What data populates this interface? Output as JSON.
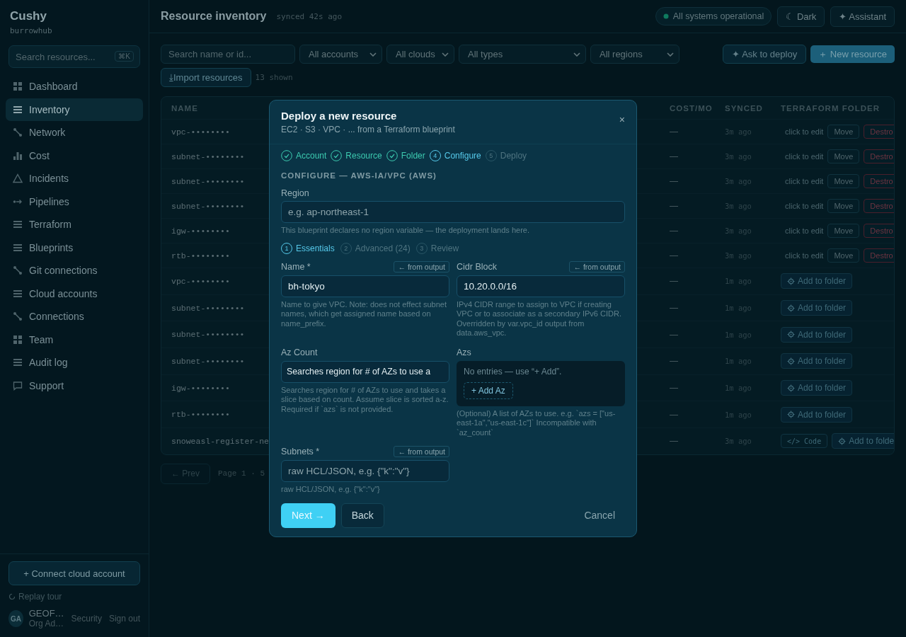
{
  "sidebar": {
    "logo": "Cushy",
    "workspace": "burrowhub",
    "search": {
      "placeholder": "Search resources...",
      "shortcut": "⌘K"
    },
    "nav": [
      {
        "label": "Dashboard",
        "kind": "grid",
        "selected": false
      },
      {
        "label": "Inventory",
        "kind": "stack",
        "selected": true
      },
      {
        "label": "Network",
        "kind": "branch",
        "selected": false
      },
      {
        "label": "Cost",
        "kind": "bars",
        "selected": false
      },
      {
        "label": "Incidents",
        "kind": "triangle",
        "selected": false
      },
      {
        "label": "Pipelines",
        "kind": "flow",
        "selected": false
      },
      {
        "label": "Terraform",
        "kind": "stack",
        "selected": false
      },
      {
        "label": "Blueprints",
        "kind": "stack",
        "selected": false
      },
      {
        "label": "Git connections",
        "kind": "branch",
        "selected": false
      },
      {
        "label": "Cloud accounts",
        "kind": "stack",
        "selected": false
      },
      {
        "label": "Connections",
        "kind": "branch",
        "selected": false
      },
      {
        "label": "Team",
        "kind": "grid",
        "selected": false
      },
      {
        "label": "Audit log",
        "kind": "stack",
        "selected": false
      },
      {
        "label": "Support",
        "kind": "chat",
        "selected": false
      }
    ],
    "connect_button": "+ Connect cloud account",
    "replay": "Replay tour",
    "user": {
      "initials": "GA",
      "name": "GEOF…",
      "role": "Org Ad…"
    },
    "links": [
      "Security",
      "Sign out"
    ]
  },
  "header": {
    "title": "Resource inventory",
    "synced": "synced 42s ago",
    "status": "All systems operational",
    "buttons": [
      "☾ Dark",
      "✦ Assistant"
    ]
  },
  "filters": {
    "search": {
      "placeholder": "Search name or id..."
    },
    "selects": [
      "All accounts",
      "All clouds",
      "All types",
      "All regions"
    ],
    "ask_button": "✦ Ask to deploy",
    "new_button": "＋ New resource",
    "import_button": "⤓Import resources",
    "count": "13 shown"
  },
  "table": {
    "columns": [
      "NAME",
      "COST/MO",
      "SYNCED",
      "TERRAFORM FOLDER"
    ],
    "rows": [
      {
        "name": "vpc-••••••••",
        "cost": "—",
        "synced": "3m ago",
        "folder": {
          "kind": "edit",
          "hint": "click to edit",
          "move": "Move",
          "destroy": "Destro"
        }
      },
      {
        "name": "subnet-••••••••",
        "cost": "—",
        "synced": "3m ago",
        "folder": {
          "kind": "edit",
          "hint": "click to edit",
          "move": "Move",
          "destroy": "Destro"
        }
      },
      {
        "name": "subnet-••••••••",
        "cost": "—",
        "synced": "3m ago",
        "folder": {
          "kind": "edit",
          "hint": "click to edit",
          "move": "Move",
          "destroy": "Destro"
        }
      },
      {
        "name": "subnet-••••••••",
        "cost": "—",
        "synced": "3m ago",
        "folder": {
          "kind": "edit",
          "hint": "click to edit",
          "move": "Move",
          "destroy": "Destro"
        }
      },
      {
        "name": "igw-••••••••",
        "cost": "—",
        "synced": "3m ago",
        "folder": {
          "kind": "edit",
          "hint": "click to edit",
          "move": "Move",
          "destroy": "Destro"
        }
      },
      {
        "name": "rtb-••••••••",
        "cost": "—",
        "synced": "3m ago",
        "folder": {
          "kind": "edit",
          "hint": "click to edit",
          "move": "Move",
          "destroy": "Destro"
        }
      },
      {
        "name": "vpc-••••••••",
        "cost": "—",
        "synced": "1m ago",
        "folder": {
          "kind": "add",
          "add": "Add to folder"
        }
      },
      {
        "name": "subnet-••••••••",
        "cost": "—",
        "synced": "1m ago",
        "folder": {
          "kind": "add",
          "add": "Add to folder"
        }
      },
      {
        "name": "subnet-••••••••",
        "cost": "—",
        "synced": "1m ago",
        "folder": {
          "kind": "add",
          "add": "Add to folder"
        }
      },
      {
        "name": "subnet-••••••••",
        "cost": "—",
        "synced": "1m ago",
        "folder": {
          "kind": "add",
          "add": "Add to folder"
        }
      },
      {
        "name": "igw-••••••••",
        "cost": "—",
        "synced": "1m ago",
        "folder": {
          "kind": "add",
          "add": "Add to folder"
        }
      },
      {
        "name": "rtb-••••••••",
        "cost": "—",
        "synced": "1m ago",
        "folder": {
          "kind": "add",
          "add": "Add to folder"
        }
      },
      {
        "name": "snoweasl-register-ne",
        "cost": "—",
        "synced": "3m ago",
        "folder": {
          "kind": "code",
          "code": "</> Code",
          "add": "Add to folde"
        }
      }
    ]
  },
  "pagination": {
    "prev": "← Prev",
    "page": "Page 1 · 5"
  },
  "modal": {
    "title": "Deploy a new resource",
    "subtitle": "EC2 · S3 · VPC · ... from a Terraform blueprint",
    "close": "×",
    "steps": [
      {
        "label": "Account",
        "done": true,
        "selected": false
      },
      {
        "label": "Resource",
        "done": true,
        "selected": false
      },
      {
        "label": "Folder",
        "done": true,
        "selected": false
      },
      {
        "label": "Configure",
        "number": "4",
        "done": false,
        "selected": true
      },
      {
        "label": "Deploy",
        "number": "5",
        "done": false,
        "selected": false
      }
    ],
    "section": "CONFIGURE — AWS-IA/VPC (AWS)",
    "region": {
      "label": "Region",
      "placeholder": "e.g. ap-northeast-1",
      "help": "This blueprint declares no region variable — the deployment lands here."
    },
    "substeps": [
      {
        "number": "1",
        "label": "Essentials",
        "selected": true
      },
      {
        "number": "2",
        "label": "Advanced (24)",
        "selected": false
      },
      {
        "number": "3",
        "label": "Review",
        "selected": false
      }
    ],
    "fields": [
      {
        "kind": "input",
        "label": "Name *",
        "link": "← from output",
        "value": "bh-tokyo",
        "help": "Name to give VPC. Note: does not effect subnet names, which get assigned name based on name_prefix."
      },
      {
        "kind": "input",
        "label": "Cidr Block",
        "link": "← from output",
        "value": "10.20.0.0/16",
        "help": "IPv4 CIDR range to assign to VPC if creating VPC or to associate as a secondary IPv6 CIDR. Overridden by var.vpc_id output from data.aws_vpc."
      },
      {
        "kind": "input",
        "label": "Az Count",
        "value": "Searches region for # of AZs to use a",
        "help": "Searches region for # of AZs to use and takes a slice based on count. Assume slice is sorted a-z. Required if `azs` is not provided."
      },
      {
        "kind": "list",
        "label": "Azs",
        "empty": "No entries — use “+ Add”.",
        "add": "+ Add Az",
        "help": "(Optional) A list of AZs to use. e.g. `azs = [\"us-east-1a\",\"us-east-1c\"]` Incompatible with `az_count`"
      },
      {
        "kind": "input",
        "label": "Subnets *",
        "link": "← from output",
        "placeholder": "raw HCL/JSON, e.g. {\"k\":\"v\"}",
        "help": "raw HCL/JSON, e.g. {\"k\":\"v\"}"
      }
    ],
    "next": "Next →",
    "back": "Back",
    "cancel": "Cancel"
  }
}
